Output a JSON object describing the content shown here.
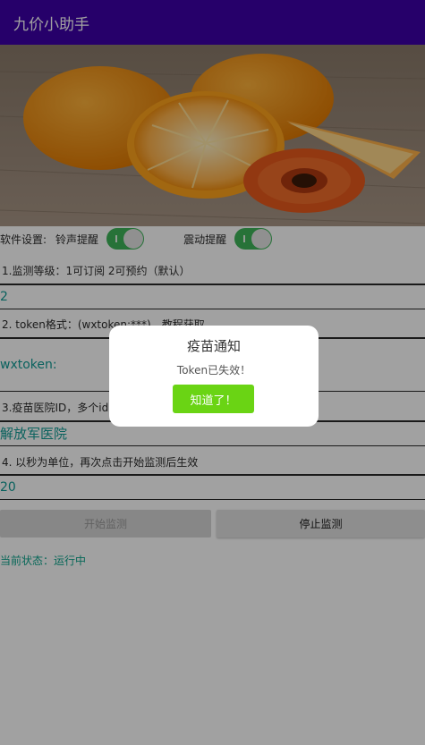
{
  "app": {
    "title": "九价小助手"
  },
  "settings": {
    "label": "软件设置:",
    "ring_label": "铃声提醒",
    "vibrate_label": "震动提醒",
    "ring_on": true,
    "vibrate_on": true
  },
  "monitor_level": {
    "desc": "1.监测等级：1可订阅 2可预约（默认）",
    "value": "2"
  },
  "token": {
    "desc": "2. token格式：(wxtoken:***)，教程获取",
    "value": "wxtoken:"
  },
  "hospital": {
    "desc": "3.疫苗医院ID，多个id中文",
    "value": "解放军医院"
  },
  "interval": {
    "desc": "4. 以秒为单位，再次点击开始监测后生效",
    "value": "20"
  },
  "buttons": {
    "start": "开始监测",
    "stop": "停止监测"
  },
  "status": {
    "text": "当前状态：运行中"
  },
  "dialog": {
    "title": "疫苗通知",
    "message": "Token已失效！",
    "confirm": "知道了！"
  },
  "colors": {
    "appbar": "#3d00a8",
    "accent_text": "#109c96",
    "toggle_on": "#3fb55a",
    "dialog_button": "#6ad414"
  }
}
